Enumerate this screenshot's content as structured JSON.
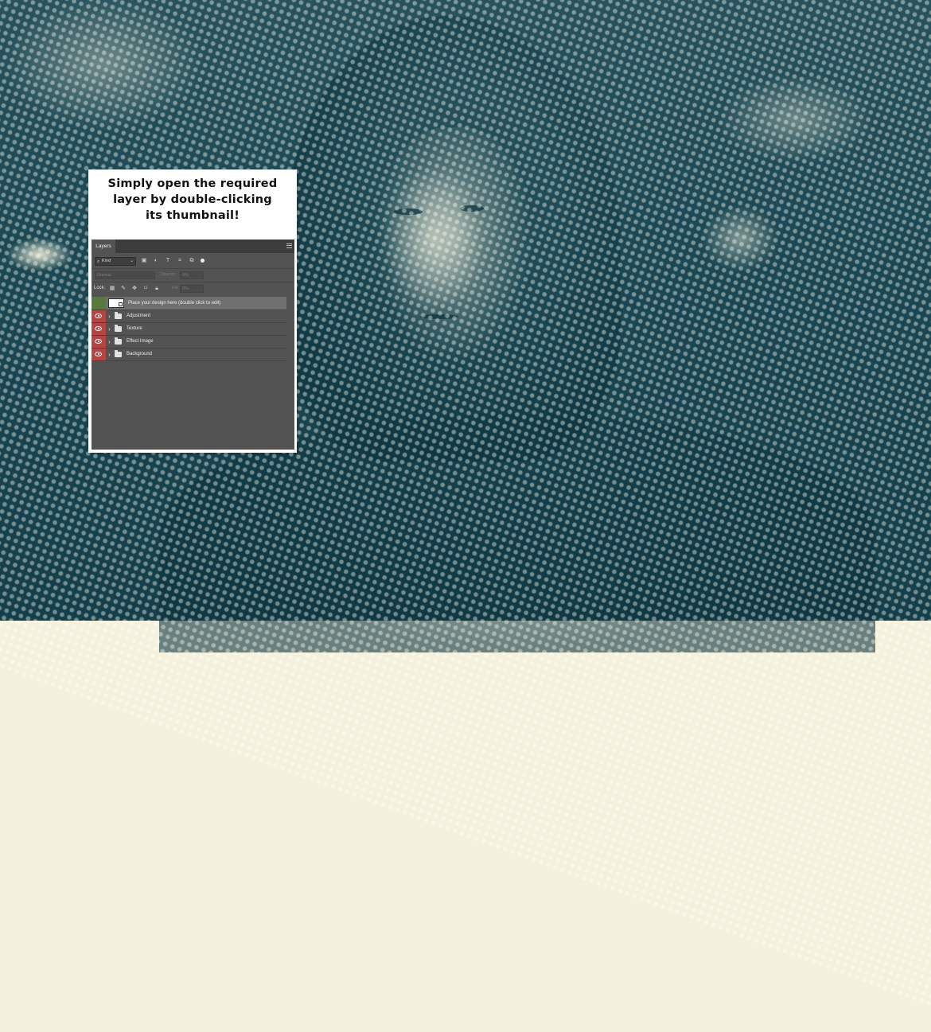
{
  "card": {
    "title_line1": "Simply open the required",
    "title_line2": "layer by double-clicking",
    "title_line3": "its thumbnail!"
  },
  "layers_panel": {
    "tab_label": "Layers",
    "filter": {
      "kind_label": "Kind",
      "icons": [
        "image-filter-icon",
        "adjustment-filter-icon",
        "type-filter-icon",
        "shape-filter-icon",
        "smart-object-filter-icon"
      ]
    },
    "blend_mode": "Normal",
    "opacity_label": "Opacity:",
    "opacity_value": "0%",
    "lock_label": "Lock:",
    "lock_icons": [
      "lock-transparent-icon",
      "lock-paint-icon",
      "lock-move-icon",
      "lock-artboard-icon",
      "lock-all-icon"
    ],
    "fill_label": "Fill:",
    "fill_value": "0%",
    "layers": [
      {
        "name": "Place your design here (double click to edit)",
        "type": "smart-object",
        "selected": true,
        "visible": false
      },
      {
        "name": "Adjustment",
        "type": "group",
        "selected": false,
        "visible": true
      },
      {
        "name": "Texture",
        "type": "group",
        "selected": false,
        "visible": true
      },
      {
        "name": "Effect Image",
        "type": "group",
        "selected": false,
        "visible": true
      },
      {
        "name": "Background",
        "type": "group",
        "selected": false,
        "visible": true
      }
    ]
  },
  "colors": {
    "halftone_dark": "#153f4b",
    "halftone_light": "#f4f1dc",
    "visibility_red": "#b34545",
    "selected_green": "#587a3f"
  }
}
